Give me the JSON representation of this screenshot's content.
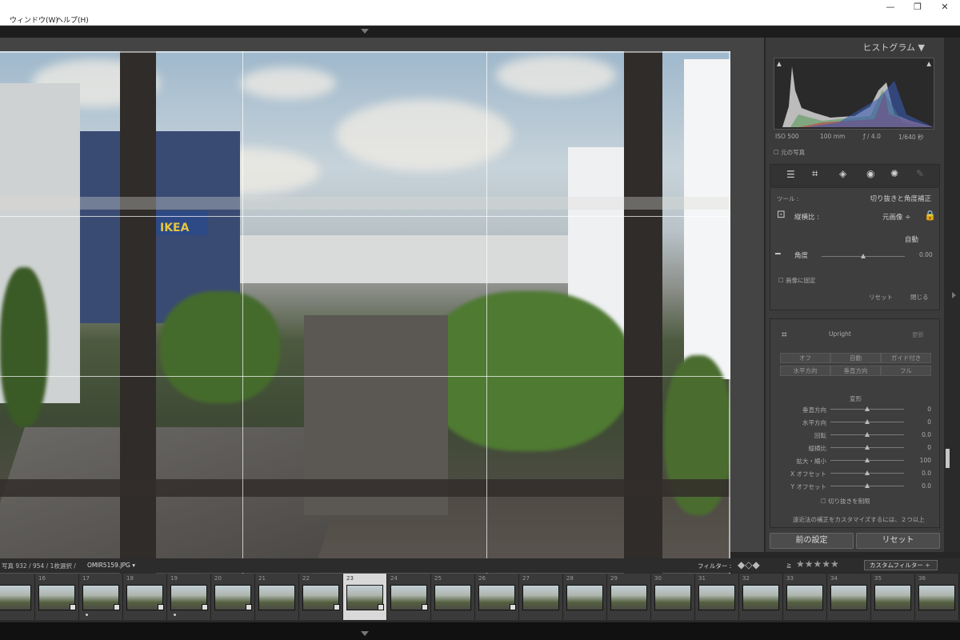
{
  "menubar": {
    "items": [
      "ウィンドウ(W)",
      "ヘルプ(H)"
    ]
  },
  "window_controls": {
    "minimize": "—",
    "restore": "❐",
    "close": "✕"
  },
  "histogram_panel": {
    "title": "ヒストグラム ▼",
    "iso": "ISO 500",
    "focal": "100 mm",
    "aperture": "ƒ / 4.0",
    "shutter": "1/640 秒",
    "original_photo_label": "元の写真"
  },
  "crop_tool": {
    "tool_label": "ツール :",
    "tool_name": "切り抜きと角度補正",
    "aspect_label": "縦横比 :",
    "aspect_value": "元画像 ÷",
    "auto_label": "自動",
    "angle_label": "角度",
    "angle_value": "0.00",
    "angle_level": 0.5,
    "constrain_label": "画像に固定",
    "reset_label": "リセット",
    "close_label": "閉じる"
  },
  "transform_panel": {
    "upright_label": "Upright",
    "update_label": "更新",
    "buttons": [
      "オフ",
      "自動",
      "ガイド付き",
      "水平方向",
      "垂直方向",
      "フル"
    ],
    "section_title": "変形",
    "sliders": [
      {
        "label": "垂直方向",
        "value": "0"
      },
      {
        "label": "水平方向",
        "value": "0"
      },
      {
        "label": "回転",
        "value": "0.0"
      },
      {
        "label": "縦横比",
        "value": "0"
      },
      {
        "label": "拡大・縮小",
        "value": "100"
      },
      {
        "label": "X オフセット",
        "value": "0.0"
      },
      {
        "label": "Y オフセット",
        "value": "0.0"
      }
    ],
    "constrain_crop_label": "切り抜きを制限",
    "hint_text": "遠近法の補正をカスタマイズするには、２つ以上"
  },
  "bottom_buttons": {
    "prev": "前の設定",
    "reset": "リセット"
  },
  "filmstrip_bar": {
    "info": "写真 932 / 954 / 1枚選択 /",
    "filename": "OMIR5159.JPG ▾",
    "filter_label": "フィルター :",
    "stars_prefix": "≧",
    "stars": "★★★★★",
    "custom_filter": "カスタムフィルター ÷"
  },
  "filmstrip": {
    "frames": [
      {
        "num": "",
        "badge": false,
        "dot": false
      },
      {
        "num": "16",
        "badge": true,
        "dot": false
      },
      {
        "num": "17",
        "badge": true,
        "dot": true
      },
      {
        "num": "18",
        "badge": true,
        "dot": false
      },
      {
        "num": "19",
        "badge": true,
        "dot": true
      },
      {
        "num": "20",
        "badge": true,
        "dot": false
      },
      {
        "num": "21",
        "badge": false,
        "dot": false
      },
      {
        "num": "22",
        "badge": true,
        "dot": false
      },
      {
        "num": "23",
        "badge": true,
        "dot": false,
        "selected": true
      },
      {
        "num": "24",
        "badge": true,
        "dot": false
      },
      {
        "num": "25",
        "badge": false,
        "dot": false
      },
      {
        "num": "26",
        "badge": true,
        "dot": false
      },
      {
        "num": "27",
        "badge": false,
        "dot": false
      },
      {
        "num": "28",
        "badge": false,
        "dot": false
      },
      {
        "num": "29",
        "badge": false,
        "dot": false
      },
      {
        "num": "30",
        "badge": false,
        "dot": false
      },
      {
        "num": "31",
        "badge": false,
        "dot": false
      },
      {
        "num": "32",
        "badge": false,
        "dot": false
      },
      {
        "num": "33",
        "badge": false,
        "dot": false
      },
      {
        "num": "34",
        "badge": false,
        "dot": false
      },
      {
        "num": "35",
        "badge": false,
        "dot": false
      },
      {
        "num": "36",
        "badge": false,
        "dot": false
      }
    ]
  },
  "photo": {
    "sign_text": "IKEA"
  },
  "colors": {
    "accent": "#d7c26a",
    "panel_bg": "#3b3b3b",
    "selected_frame": "#d9d9d9"
  }
}
